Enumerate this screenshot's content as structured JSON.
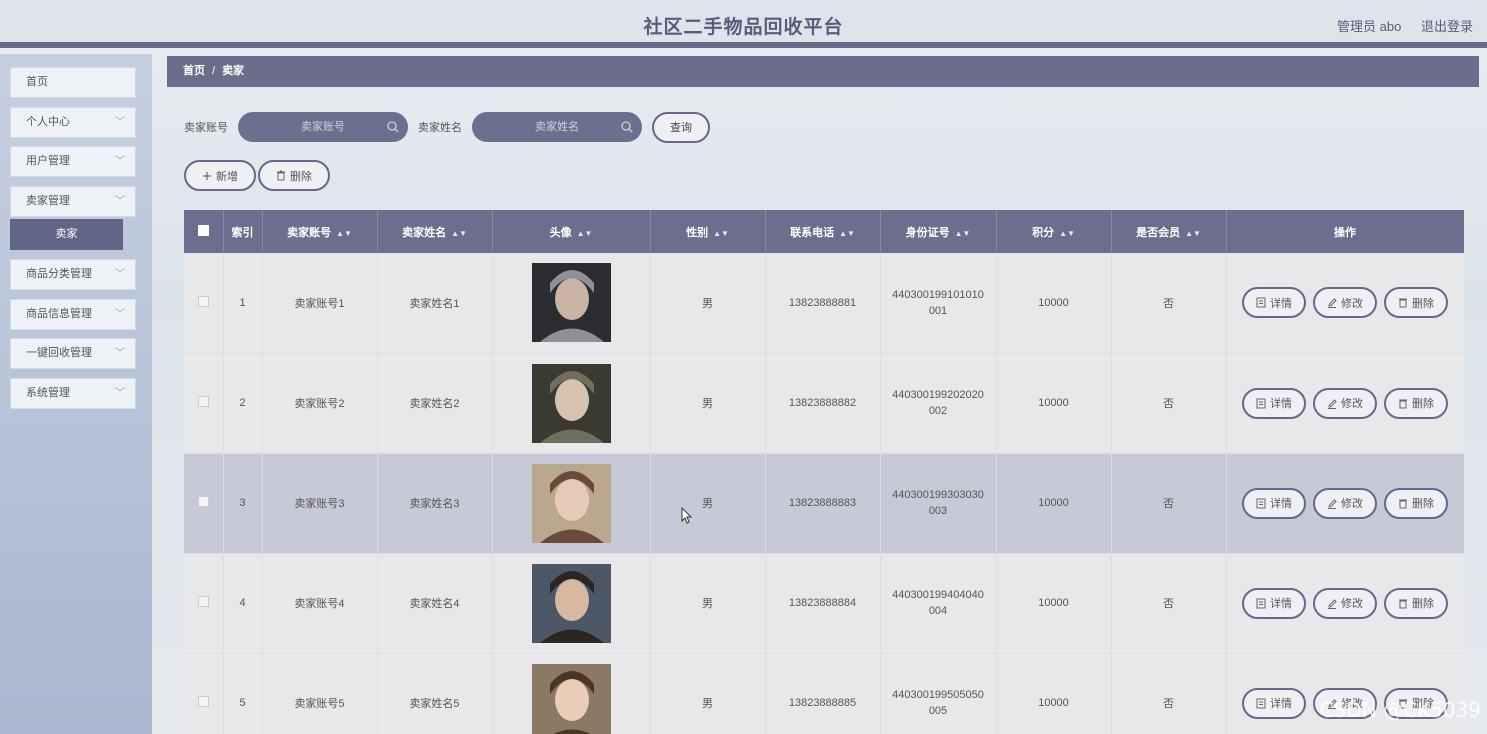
{
  "header": {
    "title": "社区二手物品回收平台",
    "user_label": "管理员 abo",
    "logout_label": "退出登录"
  },
  "sidebar": {
    "items": [
      {
        "label": "首页",
        "has_chevron": false
      },
      {
        "label": "个人中心",
        "has_chevron": true
      },
      {
        "label": "用户管理",
        "has_chevron": true
      },
      {
        "label": "卖家管理",
        "has_chevron": true
      },
      {
        "label": "商品分类管理",
        "has_chevron": true
      },
      {
        "label": "商品信息管理",
        "has_chevron": true
      },
      {
        "label": "一键回收管理",
        "has_chevron": true
      },
      {
        "label": "系统管理",
        "has_chevron": true
      }
    ],
    "active_sub": "卖家"
  },
  "breadcrumb": {
    "home": "首页",
    "separator": "/",
    "current": "卖家"
  },
  "search": {
    "account_label": "卖家账号",
    "account_placeholder": "卖家账号",
    "name_label": "卖家姓名",
    "name_placeholder": "卖家姓名",
    "query_label": "查询"
  },
  "actions": {
    "add_label": "新增",
    "delete_label": "删除"
  },
  "table": {
    "columns": [
      "索引",
      "卖家账号",
      "卖家姓名",
      "头像",
      "性别",
      "联系电话",
      "身份证号",
      "积分",
      "是否会员",
      "操作"
    ],
    "rows": [
      {
        "index": "1",
        "account": "卖家账号1",
        "name": "卖家姓名1",
        "gender": "男",
        "phone": "13823888881",
        "id_line1": "440300199101010",
        "id_line2": "001",
        "points": "10000",
        "member": "否"
      },
      {
        "index": "2",
        "account": "卖家账号2",
        "name": "卖家姓名2",
        "gender": "男",
        "phone": "13823888882",
        "id_line1": "440300199202020",
        "id_line2": "002",
        "points": "10000",
        "member": "否"
      },
      {
        "index": "3",
        "account": "卖家账号3",
        "name": "卖家姓名3",
        "gender": "男",
        "phone": "13823888883",
        "id_line1": "440300199303030",
        "id_line2": "003",
        "points": "10000",
        "member": "否"
      },
      {
        "index": "4",
        "account": "卖家账号4",
        "name": "卖家姓名4",
        "gender": "男",
        "phone": "13823888884",
        "id_line1": "440300199404040",
        "id_line2": "004",
        "points": "10000",
        "member": "否"
      },
      {
        "index": "5",
        "account": "卖家账号5",
        "name": "卖家姓名5",
        "gender": "男",
        "phone": "13823888885",
        "id_line1": "440300199505050",
        "id_line2": "005",
        "points": "10000",
        "member": "否"
      }
    ],
    "highlighted_row": 3,
    "row_actions": {
      "detail": "详情",
      "edit": "修改",
      "delete": "删除"
    }
  },
  "watermark": "CSDN @CK5039",
  "colors": {
    "accent": "#676789",
    "header_bg": "#dfe4ea",
    "sidebar_active": "#636587"
  }
}
